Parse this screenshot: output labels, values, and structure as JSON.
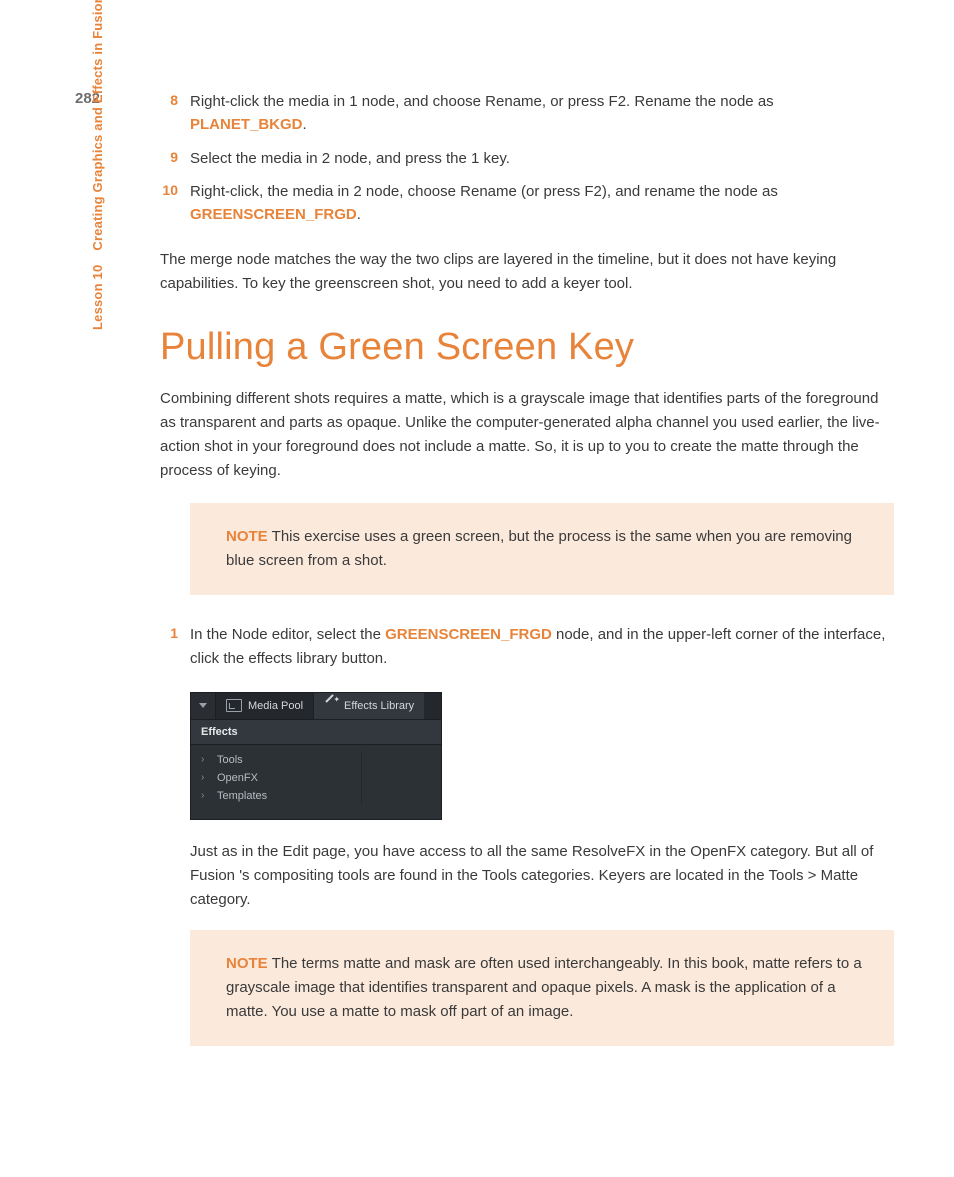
{
  "page_number": "282",
  "sidebar": {
    "lesson": "Lesson 10",
    "title": "Creating Graphics and Effects in Fusion"
  },
  "steps_top": [
    {
      "num": "8",
      "pre": "Right-click the media in 1 node, and choose Rename, or press F2. Rename the node as ",
      "kw": "PLANET_BKGD",
      "post": "."
    },
    {
      "num": "9",
      "text": "Select the media in 2 node, and press the 1 key."
    },
    {
      "num": "10",
      "pre": "Right-click, the media in 2 node, choose Rename (or press F2), and rename the node as ",
      "kw": "GREENSCREEN_FRGD",
      "post": "."
    }
  ],
  "para_merge": "The merge node matches the way the two clips are layered in the timeline, but it does not have keying capabilities. To key the greenscreen shot, you need to add a keyer tool.",
  "section_title": "Pulling a Green Screen Key",
  "para_intro": "Combining different shots requires a matte, which is a grayscale image that identifies parts of the foreground as transparent and parts as opaque. Unlike the computer-generated alpha channel you used earlier, the live-action shot in your foreground does not include a matte. So, it is up to you to create the matte through the process of keying.",
  "note1": {
    "label": "NOTE",
    "text": "This exercise uses a green screen, but the process is the same when you are removing blue screen from a shot."
  },
  "step1": {
    "num": "1",
    "pre": "In the Node editor, select the ",
    "kw": "GREENSCREEN_FRGD",
    "post": " node, and in the upper-left corner of the interface, click the effects library button."
  },
  "ui": {
    "media_pool": "Media Pool",
    "effects_library": "Effects Library",
    "effects_header": "Effects",
    "tree": [
      "Tools",
      "OpenFX",
      "Templates"
    ]
  },
  "para_after_ui": "Just as in the Edit page, you have access to all the same ResolveFX in the OpenFX category. But all of Fusion 's compositing tools are found in the Tools categories. Keyers are located in the Tools > Matte category.",
  "note2": {
    "label": "NOTE",
    "text": "The terms matte and mask are often used interchangeably. In this book, matte refers to a grayscale image that identifies transparent and opaque pixels. A mask is the application of a matte. You use a matte to mask off part of an image."
  }
}
